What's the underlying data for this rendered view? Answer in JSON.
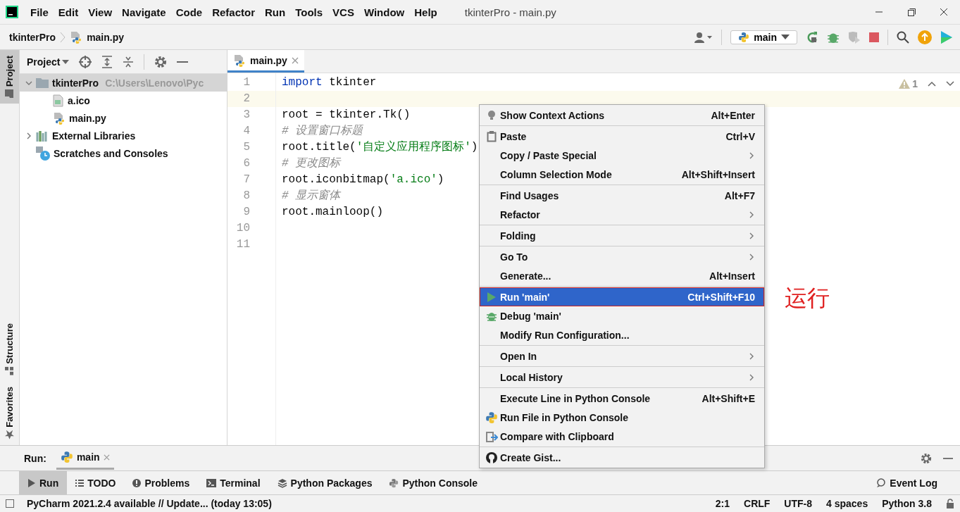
{
  "title_bar": {
    "menu": [
      "File",
      "Edit",
      "View",
      "Navigate",
      "Code",
      "Refactor",
      "Run",
      "Tools",
      "VCS",
      "Window",
      "Help"
    ],
    "title": "tkinterPro - main.py"
  },
  "nav_bar": {
    "breadcrumb": [
      "tkinterPro",
      "main.py"
    ],
    "run_config": "main"
  },
  "left_stripe": [
    {
      "label": "Project",
      "selected": true
    },
    {
      "label": "Structure",
      "selected": false
    },
    {
      "label": "Favorites",
      "selected": false
    }
  ],
  "project_panel": {
    "title": "Project",
    "tree": [
      {
        "label": "tkinterPro",
        "path": "C:\\Users\\Lenovo\\Pyc",
        "kind": "folder",
        "expanded": true,
        "selected": true,
        "children": [
          {
            "label": "a.ico",
            "kind": "image",
            "selected": false
          },
          {
            "label": "main.py",
            "kind": "python",
            "selected": false
          }
        ]
      },
      {
        "label": "External Libraries",
        "kind": "libraries",
        "expanded": false,
        "selected": false
      },
      {
        "label": "Scratches and Consoles",
        "kind": "scratches",
        "selected": false
      }
    ]
  },
  "editor": {
    "tabs": [
      {
        "label": "main.py",
        "selected": true
      }
    ],
    "warnings": "1",
    "lines": [
      {
        "number": "1",
        "current": false,
        "tokens": [
          {
            "kind": "keyword",
            "text": "import"
          },
          {
            "kind": "plain",
            "text": " tkinter"
          }
        ]
      },
      {
        "number": "2",
        "current": true
      },
      {
        "number": "3",
        "current": false,
        "tokens": [
          {
            "kind": "plain",
            "text": "root = tkinter.Tk()"
          }
        ]
      },
      {
        "number": "4",
        "current": false,
        "tokens": [
          {
            "kind": "comment",
            "text": "# 设置窗口标题"
          }
        ]
      },
      {
        "number": "5",
        "current": false,
        "tokens": [
          {
            "kind": "plain",
            "text": "root.title("
          },
          {
            "kind": "string",
            "text": "'自定义应用程序图标'"
          },
          {
            "kind": "plain",
            "text": ")"
          }
        ]
      },
      {
        "number": "6",
        "current": false,
        "tokens": [
          {
            "kind": "comment",
            "text": "# 更改图标"
          }
        ]
      },
      {
        "number": "7",
        "current": false,
        "tokens": [
          {
            "kind": "plain",
            "text": "root.iconbitmap("
          },
          {
            "kind": "string",
            "text": "'a.ico'"
          },
          {
            "kind": "plain",
            "text": ")"
          }
        ]
      },
      {
        "number": "8",
        "current": false,
        "tokens": [
          {
            "kind": "comment",
            "text": "# 显示窗体"
          }
        ]
      },
      {
        "number": "9",
        "current": false,
        "tokens": [
          {
            "kind": "plain",
            "text": "root.mainloop()"
          }
        ]
      },
      {
        "number": "10",
        "current": false
      },
      {
        "number": "11",
        "current": false
      }
    ]
  },
  "context_menu": {
    "groups": [
      [
        {
          "label": "Show Context Actions",
          "shortcut": "Alt+Enter",
          "submenu": false,
          "selected": false
        }
      ],
      [
        {
          "label": "Paste",
          "shortcut": "Ctrl+V",
          "submenu": false,
          "selected": false
        },
        {
          "label": "Copy / Paste Special",
          "submenu": true,
          "selected": false
        },
        {
          "label": "Column Selection Mode",
          "shortcut": "Alt+Shift+Insert",
          "submenu": false,
          "selected": false
        }
      ],
      [
        {
          "label": "Find Usages",
          "shortcut": "Alt+F7",
          "submenu": false,
          "selected": false
        },
        {
          "label": "Refactor",
          "submenu": true,
          "selected": false
        }
      ],
      [
        {
          "label": "Folding",
          "submenu": true,
          "selected": false
        }
      ],
      [
        {
          "label": "Go To",
          "submenu": true,
          "selected": false
        },
        {
          "label": "Generate...",
          "shortcut": "Alt+Insert",
          "submenu": false,
          "selected": false
        }
      ],
      [
        {
          "label": "Run 'main'",
          "shortcut": "Ctrl+Shift+F10",
          "submenu": false,
          "selected": true
        },
        {
          "label": "Debug 'main'",
          "submenu": false,
          "selected": false
        },
        {
          "label": "Modify Run Configuration...",
          "submenu": false,
          "selected": false
        }
      ],
      [
        {
          "label": "Open In",
          "submenu": true,
          "selected": false
        }
      ],
      [
        {
          "label": "Local History",
          "submenu": true,
          "selected": false
        }
      ],
      [
        {
          "label": "Execute Line in Python Console",
          "shortcut": "Alt+Shift+E",
          "submenu": false,
          "selected": false
        },
        {
          "label": "Run File in Python Console",
          "submenu": false,
          "selected": false
        },
        {
          "label": "Compare with Clipboard",
          "submenu": false,
          "selected": false
        }
      ],
      [
        {
          "label": "Create Gist...",
          "submenu": false,
          "selected": false
        }
      ]
    ]
  },
  "annotation": "运行",
  "run_panel": {
    "title": "Run:",
    "tabs": [
      {
        "label": "main",
        "selected": true
      }
    ]
  },
  "tool_windows": [
    {
      "label": "Run",
      "selected": true
    },
    {
      "label": "TODO",
      "selected": false
    },
    {
      "label": "Problems",
      "selected": false
    },
    {
      "label": "Terminal",
      "selected": false
    },
    {
      "label": "Python Packages",
      "selected": false
    },
    {
      "label": "Python Console",
      "selected": false
    },
    {
      "label": "Event Log",
      "selected": false
    }
  ],
  "status_bar": {
    "message": "PyCharm 2021.2.4 available // Update... (today 13:05)",
    "items": [
      "2:1",
      "CRLF",
      "UTF-8",
      "4 spaces",
      "Python 3.8"
    ]
  }
}
